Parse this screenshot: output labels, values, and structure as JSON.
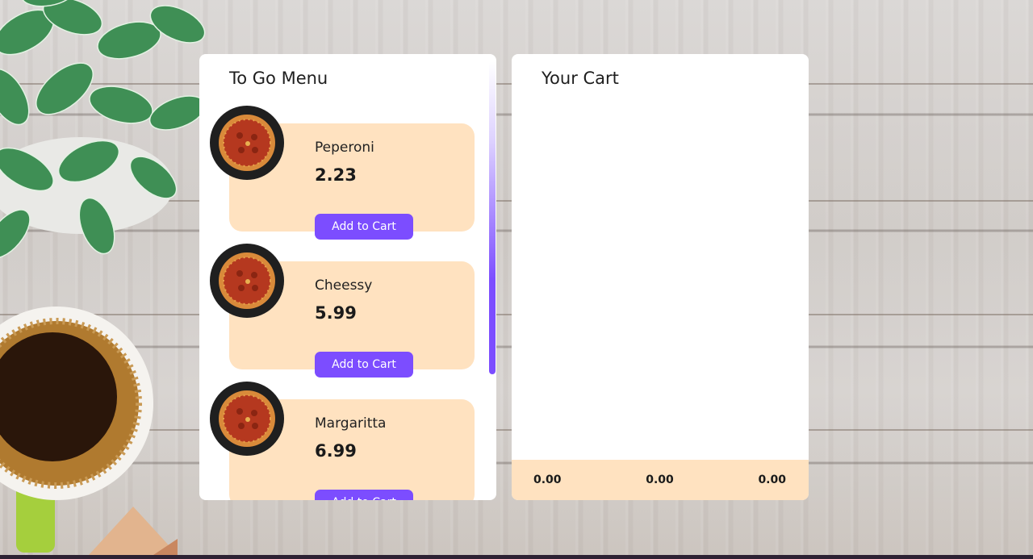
{
  "menu": {
    "title": "To Go Menu",
    "items": [
      {
        "name": "Peperoni",
        "price": "2.23",
        "button_label": "Add to Cart",
        "icon": "pizza-icon"
      },
      {
        "name": "Cheessy",
        "price": "5.99",
        "button_label": "Add to Cart",
        "icon": "pizza-icon"
      },
      {
        "name": "Margaritta",
        "price": "6.99",
        "button_label": "Add to Cart",
        "icon": "pizza-icon"
      }
    ]
  },
  "cart": {
    "title": "Your Cart",
    "totals": [
      "0.00",
      "0.00",
      "0.00"
    ]
  },
  "colors": {
    "accent": "#7c4dff",
    "card": "#ffe2c0",
    "panel": "#ffffff",
    "thumb": "#1f1f1f"
  }
}
